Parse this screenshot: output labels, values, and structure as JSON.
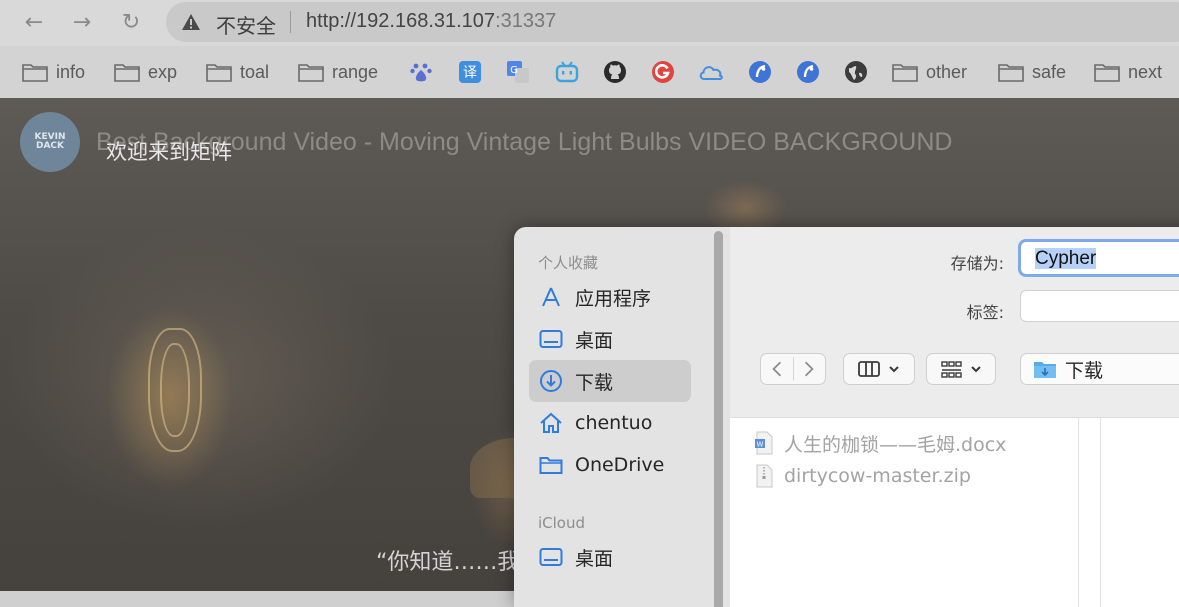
{
  "browser": {
    "nav": {
      "back_icon": "arrow-left-icon",
      "forward_icon": "arrow-right-icon",
      "reload_icon": "reload-icon"
    },
    "address": {
      "security_label": "不安全",
      "url_host": "http://192.168.31.107",
      "url_port": ":31337"
    },
    "bookmarks": {
      "folders_left": [
        "info",
        "exp",
        "toal",
        "range"
      ],
      "icons": [
        "baidu-icon",
        "translate-icon",
        "google-translate-icon",
        "bilibili-icon",
        "github-icon",
        "g-red-icon",
        "cloud-icon",
        "safari-blue-icon",
        "safari-blue-icon",
        "globe-icon"
      ],
      "folders_right": [
        "other",
        "safe",
        "next"
      ]
    }
  },
  "page": {
    "channel_logo": "KEVIN DACK",
    "video_title": "Best Background Video - Moving Vintage Light Bulbs VIDEO BACKGROUND",
    "welcome": "欢迎来到矩阵",
    "subtitle": "“你知道……我"
  },
  "dialog": {
    "sidebar": {
      "favorites_header": "个人收藏",
      "favorites": [
        {
          "label": "应用程序",
          "icon": "applications-icon"
        },
        {
          "label": "桌面",
          "icon": "desktop-icon"
        },
        {
          "label": "下载",
          "icon": "downloads-icon",
          "selected": true
        },
        {
          "label": "chentuo",
          "icon": "home-icon"
        },
        {
          "label": "OneDrive",
          "icon": "folder-icon"
        }
      ],
      "icloud_header": "iCloud",
      "icloud": [
        {
          "label": "桌面",
          "icon": "desktop-icon"
        }
      ]
    },
    "save_as_label": "存储为:",
    "save_as_value": "Cypher",
    "tags_label": "标签:",
    "tags_value": "",
    "location": "下载",
    "files": [
      {
        "name": "人生的枷锁——毛姆.docx",
        "icon": "word-doc-icon"
      },
      {
        "name": "dirtycow-master.zip",
        "icon": "zip-file-icon"
      }
    ]
  }
}
